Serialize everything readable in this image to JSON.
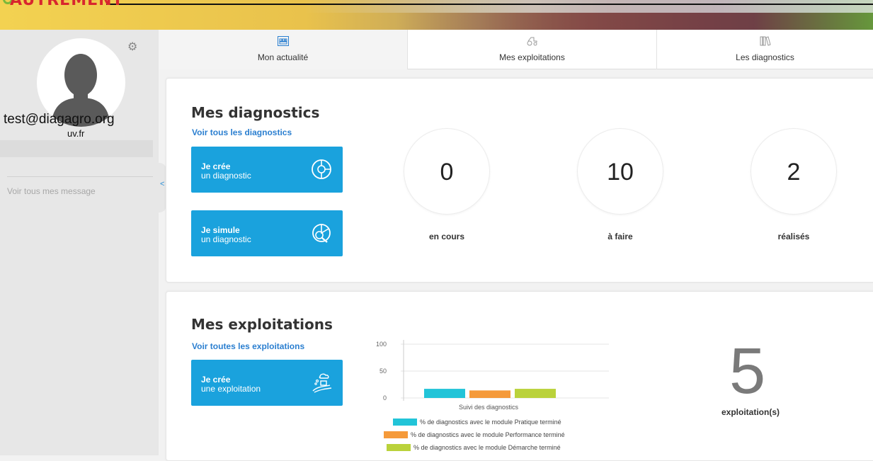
{
  "banner": {
    "logo_text": "AUTREMENT"
  },
  "sidebar": {
    "email": "test@diagagro.org",
    "email_suffix": "uv.fr",
    "messages_link": "Voir tous mes message",
    "collapse_glyph": "<"
  },
  "tabs": [
    {
      "label": "Mon actualité",
      "icon": "dashboard-icon",
      "active": true
    },
    {
      "label": "Mes exploitations",
      "icon": "tractor-icon",
      "active": false
    },
    {
      "label": "Les diagnostics",
      "icon": "books-icon",
      "active": false
    }
  ],
  "diagnostics": {
    "title": "Mes diagnostics",
    "link": "Voir tous les diagnostics",
    "create_button": {
      "line1": "Je crée",
      "line2": "un diagnostic",
      "icon": "pie-icon"
    },
    "simulate_button": {
      "line1": "Je simule",
      "line2": "un diagnostic",
      "icon": "magnifier-pie-icon"
    },
    "stats": [
      {
        "value": "0",
        "label": "en cours"
      },
      {
        "value": "10",
        "label": "à faire"
      },
      {
        "value": "2",
        "label": "réalisés"
      }
    ]
  },
  "exploitations": {
    "title": "Mes exploitations",
    "link": "Voir toutes les exploitations",
    "create_button": {
      "line1": "Je crée",
      "line2": "une exploitation",
      "icon": "farm-icon"
    },
    "count": "5",
    "count_label": "exploitation(s)"
  },
  "chart_data": {
    "type": "bar",
    "categories": [
      "Suivi des diagnostics"
    ],
    "series": [
      {
        "name": "% de diagnostics avec le module Pratique terminé",
        "values": [
          17
        ],
        "color": "#22c4d8"
      },
      {
        "name": "% de diagnostics avec le module Performance terminé",
        "values": [
          14
        ],
        "color": "#f59a3a"
      },
      {
        "name": "% de diagnostics avec le module Démarche terminé",
        "values": [
          17
        ],
        "color": "#bad23b"
      }
    ],
    "yticks": [
      "100",
      "50",
      "0"
    ],
    "ylim": [
      0,
      100
    ],
    "xlabel": "Suivi des diagnostics",
    "ylabel": "",
    "grid": true,
    "legend": "bottom"
  }
}
